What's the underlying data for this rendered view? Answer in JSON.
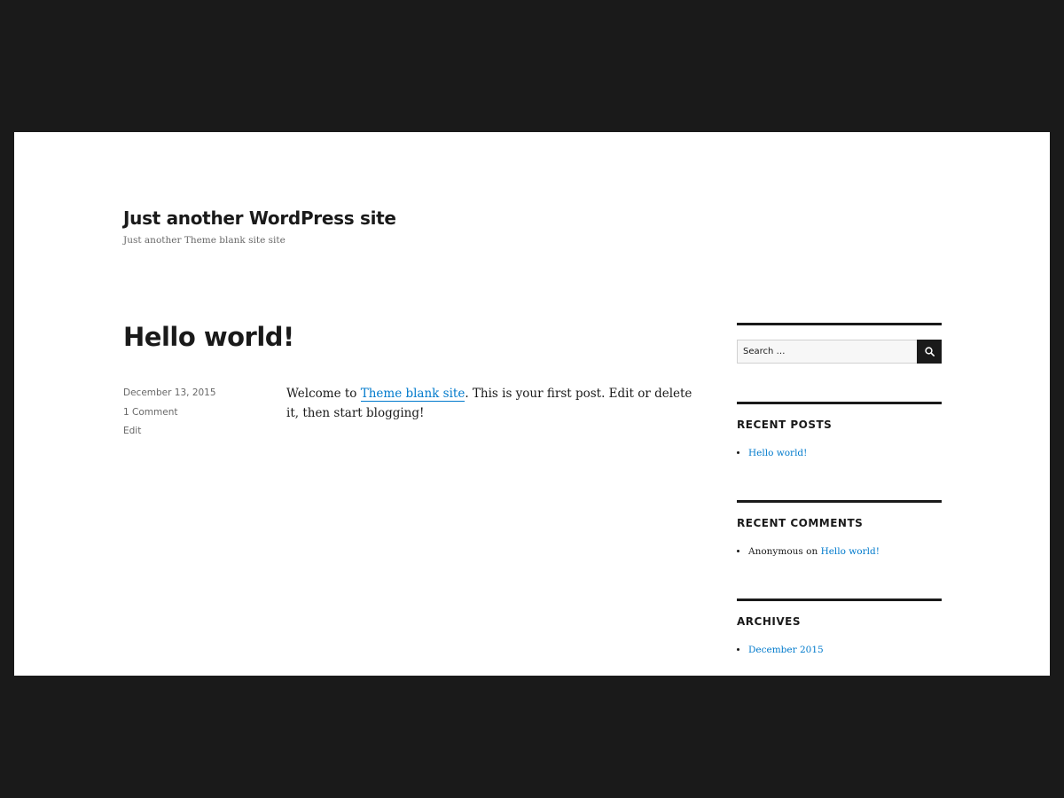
{
  "site": {
    "title": "Just another WordPress site",
    "description": "Just another Theme blank site site"
  },
  "post": {
    "title": "Hello world!",
    "date": "December 13, 2015",
    "comments": "1 Comment",
    "edit": "Edit",
    "content_before": "Welcome to ",
    "content_link": "Theme blank site",
    "content_after": ". This is your first post. Edit or delete it, then start blogging!"
  },
  "sidebar": {
    "search": {
      "placeholder": "Search …",
      "icon": "search-icon"
    },
    "recent_posts": {
      "title": "RECENT POSTS",
      "items": [
        "Hello world!"
      ]
    },
    "recent_comments": {
      "title": "RECENT COMMENTS",
      "items": [
        {
          "author": "Anonymous",
          "on": " on ",
          "post": "Hello world!"
        }
      ]
    },
    "archives": {
      "title": "ARCHIVES",
      "items": [
        "December 2015"
      ]
    }
  },
  "colors": {
    "outer_background": "#1a1a1a",
    "page_background": "#ffffff",
    "text": "#1a1a1a",
    "meta_text": "#686868",
    "link": "#007acc"
  }
}
